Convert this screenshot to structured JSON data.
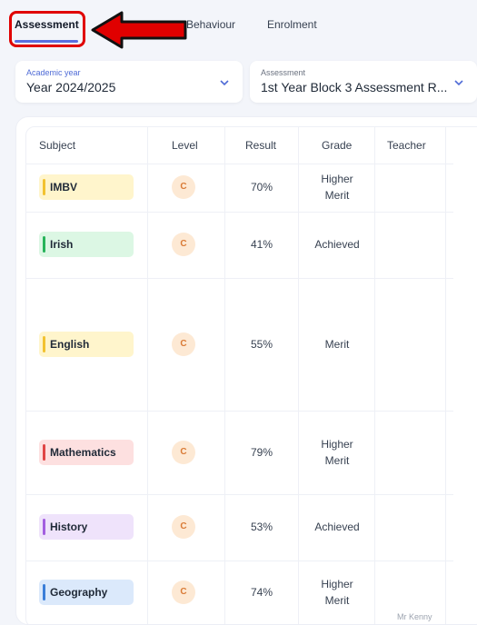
{
  "tabs": {
    "assessment": "Assessment",
    "behaviour": "Behaviour",
    "enrolment": "Enrolment"
  },
  "filters": {
    "academic_year_label": "Academic year",
    "academic_year_value": "Year 2024/2025",
    "assessment_label": "Assessment",
    "assessment_value": "1st Year Block 3 Assessment R..."
  },
  "table": {
    "headers": {
      "subject": "Subject",
      "level": "Level",
      "result": "Result",
      "grade": "Grade",
      "teacher": "Teacher"
    },
    "rows": [
      {
        "subject": "IMBV",
        "level": "C",
        "result": "70%",
        "grade_line1": "Higher",
        "grade_line2": "Merit",
        "chip_bg": "#fff5cc",
        "bar": "#f2c230"
      },
      {
        "subject": "Irish",
        "level": "C",
        "result": "41%",
        "grade_line1": "Achieved",
        "grade_line2": "",
        "chip_bg": "#dcf7e4",
        "bar": "#27b35a"
      },
      {
        "subject": "English",
        "level": "C",
        "result": "55%",
        "grade_line1": "Merit",
        "grade_line2": "",
        "chip_bg": "#fff5cc",
        "bar": "#f2c230"
      },
      {
        "subject": "Mathematics",
        "level": "C",
        "result": "79%",
        "grade_line1": "Higher",
        "grade_line2": "Merit",
        "chip_bg": "#fde0e0",
        "bar": "#e04545"
      },
      {
        "subject": "History",
        "level": "C",
        "result": "53%",
        "grade_line1": "Achieved",
        "grade_line2": "",
        "chip_bg": "#efe3fb",
        "bar": "#a35ee0"
      },
      {
        "subject": "Geography",
        "level": "C",
        "result": "74%",
        "grade_line1": "Higher",
        "grade_line2": "Merit",
        "chip_bg": "#dbe9fb",
        "bar": "#3b7ed8"
      }
    ],
    "teacher_fragment": "Mr Kenny"
  },
  "annotation": {
    "highlight_color": "#e00000",
    "arrow_icon": "arrow-left-icon"
  }
}
